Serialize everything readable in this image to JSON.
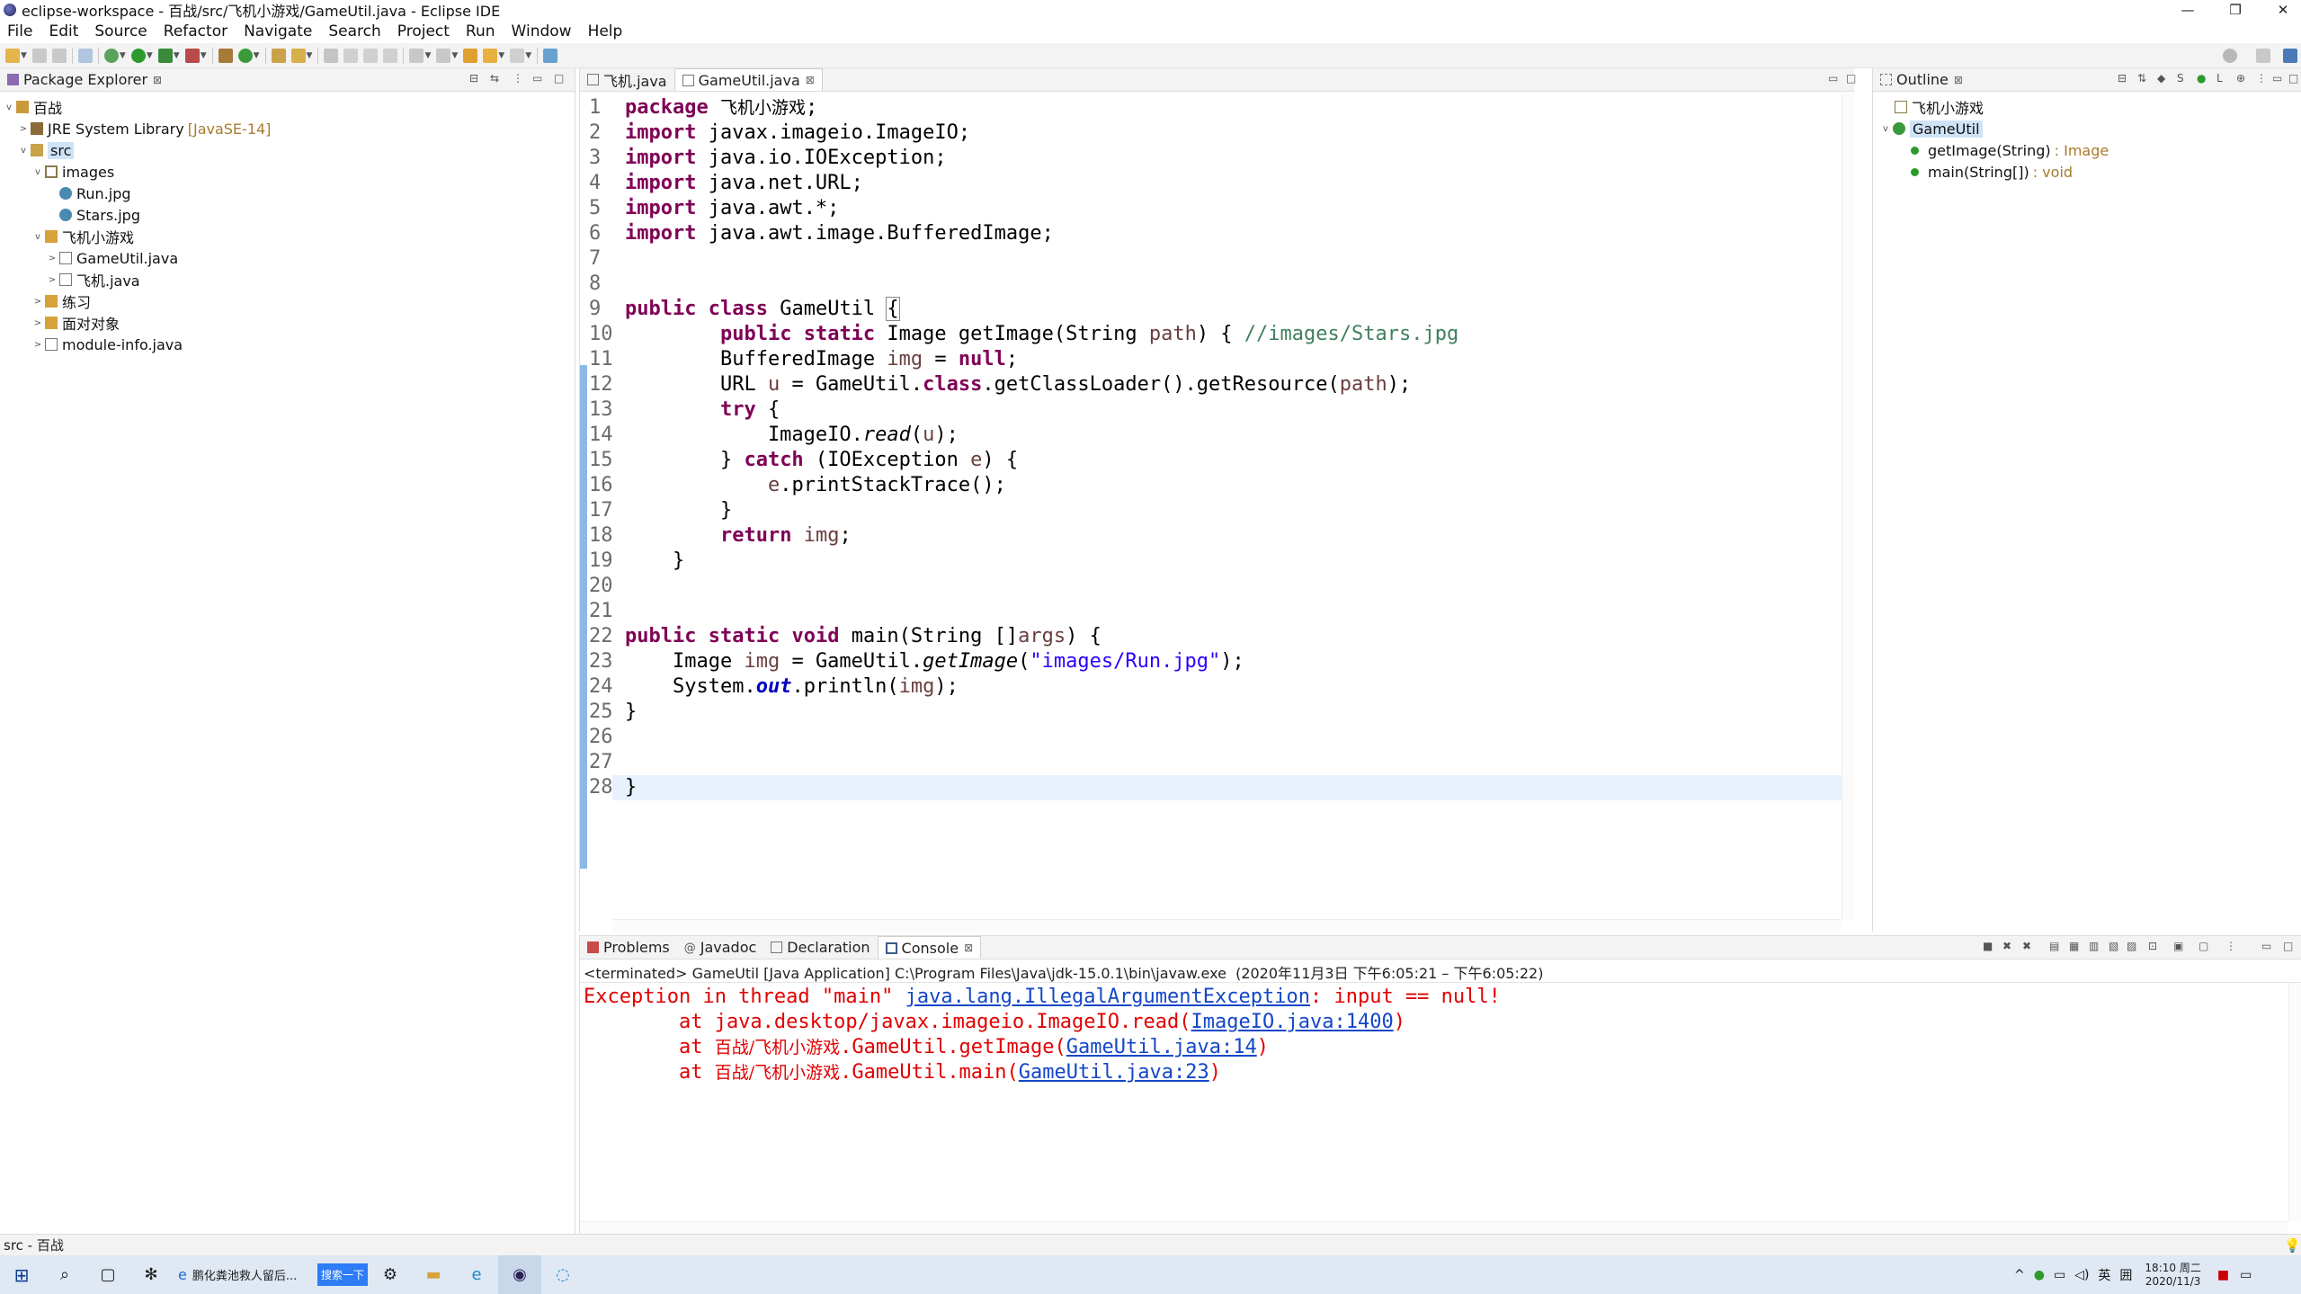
{
  "window": {
    "title": "eclipse-workspace - 百战/src/飞机小游戏/GameUtil.java - Eclipse IDE",
    "minimize": "—",
    "restore": "❐",
    "close": "✕"
  },
  "menu": [
    "File",
    "Edit",
    "Source",
    "Refactor",
    "Navigate",
    "Search",
    "Project",
    "Run",
    "Window",
    "Help"
  ],
  "package_explorer": {
    "tab_label": "Package Explorer",
    "tree": [
      {
        "label": "百战",
        "icon": "project-icon",
        "twisty": "open"
      },
      {
        "label": "JRE System Library",
        "suffix": "[JavaSE-14]",
        "icon": "library-icon",
        "twisty": "closed"
      },
      {
        "label": "src",
        "icon": "source-folder-icon",
        "twisty": "open"
      },
      {
        "label": "images",
        "icon": "package-icon",
        "twisty": "open"
      },
      {
        "label": "Run.jpg",
        "icon": "image-file-icon",
        "twisty": ""
      },
      {
        "label": "Stars.jpg",
        "icon": "image-file-icon",
        "twisty": ""
      },
      {
        "label": "飞机小游戏",
        "icon": "package-icon",
        "twisty": "open"
      },
      {
        "label": "GameUtil.java",
        "icon": "java-file-icon",
        "twisty": "closed"
      },
      {
        "label": "飞机.java",
        "icon": "java-file-icon",
        "twisty": "closed"
      },
      {
        "label": "练习",
        "icon": "package-icon",
        "twisty": "closed"
      },
      {
        "label": "面对对象",
        "icon": "package-icon",
        "twisty": "closed"
      },
      {
        "label": "module-info.java",
        "icon": "java-file-icon",
        "twisty": "closed"
      }
    ]
  },
  "editor": {
    "tabs": [
      {
        "label": "飞机.java",
        "active": false
      },
      {
        "label": "GameUtil.java",
        "active": true
      }
    ],
    "line_numbers": [
      "1",
      "2",
      "3",
      "4",
      "5",
      "6",
      "7",
      "8",
      "9",
      "10",
      "11",
      "12",
      "13",
      "14",
      "15",
      "16",
      "17",
      "18",
      "19",
      "20",
      "21",
      "22",
      "23",
      "24",
      "25",
      "26",
      "27",
      "28"
    ]
  },
  "outline": {
    "tab_label": "Outline",
    "items": [
      {
        "label": "飞机小游戏",
        "icon": "package-icon"
      },
      {
        "label": "GameUtil",
        "icon": "class-icon"
      },
      {
        "label": "getImage(String)",
        "type": ": Image",
        "icon": "public-static-method-icon"
      },
      {
        "label": "main(String[])",
        "type": ": void",
        "icon": "public-static-method-icon"
      }
    ]
  },
  "console_panel": {
    "tabs": [
      {
        "label": "Problems",
        "active": false
      },
      {
        "label": "Javadoc",
        "active": false
      },
      {
        "label": "Declaration",
        "active": false
      },
      {
        "label": "Console",
        "active": true
      }
    ],
    "header": "<terminated> GameUtil [Java Application] C:\\Program Files\\Java\\jdk-15.0.1\\bin\\javaw.exe  (2020年11月3日 下午6:05:21 – 下午6:05:22)"
  },
  "status_bar": {
    "text": "src - 百战"
  },
  "taskbar": {
    "browser_task": "鹏化粪池救人留后...",
    "search_button": "搜索一下",
    "clock_time": "18:10 周二",
    "clock_date": "2020/11/3",
    "ime": "英",
    "ime2": "囲"
  },
  "colors": {
    "keyword": "#7f0055",
    "string": "#2a00ff",
    "comment": "#3f7f5f",
    "error": "#e00000",
    "link": "#1346c8",
    "selection": "#cfe3f7"
  }
}
